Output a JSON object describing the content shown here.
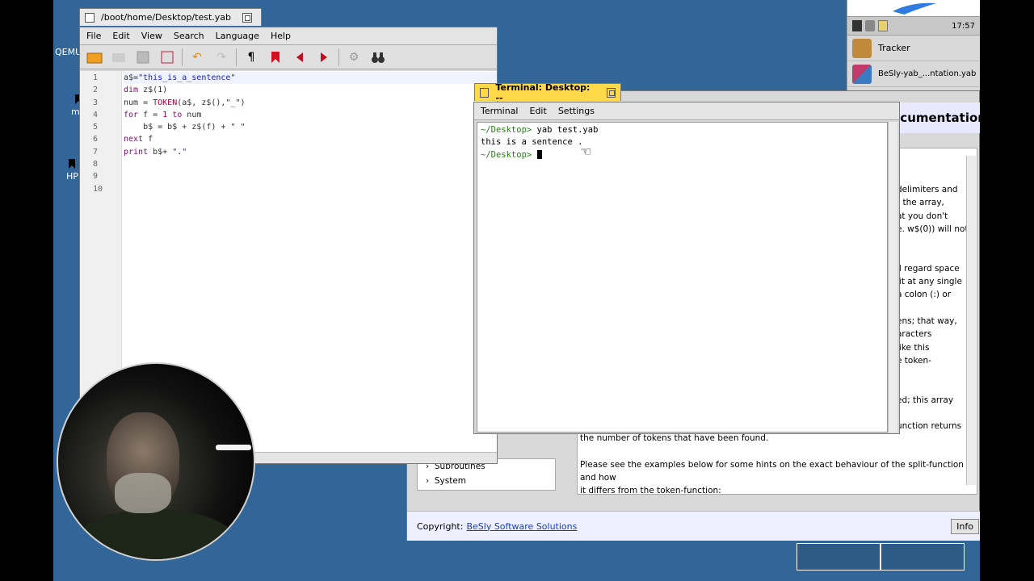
{
  "desktop": {
    "icons": [
      {
        "label": "QEMU",
        "name": "qemu"
      },
      {
        "label": "me",
        "name": "me"
      },
      {
        "label": "HP",
        "name": "hp"
      }
    ]
  },
  "deskbar": {
    "clock": "17:57",
    "apps": [
      {
        "label": "Tracker",
        "icon": "tracker-icon",
        "color": "#c08a3a"
      },
      {
        "label": "BeSly-yab_...ntation.yab",
        "icon": "yab-icon",
        "color": "#c03a6a"
      }
    ]
  },
  "editor": {
    "title": "/boot/home/Desktop/test.yab",
    "menu": [
      "File",
      "Edit",
      "View",
      "Search",
      "Language",
      "Help"
    ],
    "line_numbers": [
      "1",
      "2",
      "3",
      "4",
      "5",
      "6",
      "7",
      "8",
      "9",
      "10"
    ]
  },
  "terminal": {
    "title": "Terminal: Desktop: --",
    "menu": [
      "Terminal",
      "Edit",
      "Settings"
    ],
    "lines": [
      {
        "prompt": "~/Desktop>",
        "text": " yab test.yab"
      },
      {
        "prompt": "",
        "text": "this is a sentence ."
      },
      {
        "prompt": "~/Desktop>",
        "text": " "
      }
    ]
  },
  "doc": {
    "header": "ocumentation",
    "right_text": [
      "delimiters and",
      "t the array,",
      "at you don't",
      "e. w$(0)) will not",
      "",
      "",
      "ll regard space",
      "lit at any single",
      "a colon (:) or",
      "",
      "ens; that way,",
      "aracters",
      "like this",
      "e token-",
      "",
      "",
      "ed; this array",
      "",
      "unction returns"
    ],
    "body_text": [
      "the number of tokens that have been found.",
      "",
      "Please see the examples below for some hints on the exact behaviour of the split-function and how",
      "it differs from the token-function:"
    ],
    "tree": [
      "Subroutines",
      "System"
    ],
    "footer_label": "Copyright:",
    "footer_link": "BeSly Software Solutions",
    "info_button": "Info"
  }
}
